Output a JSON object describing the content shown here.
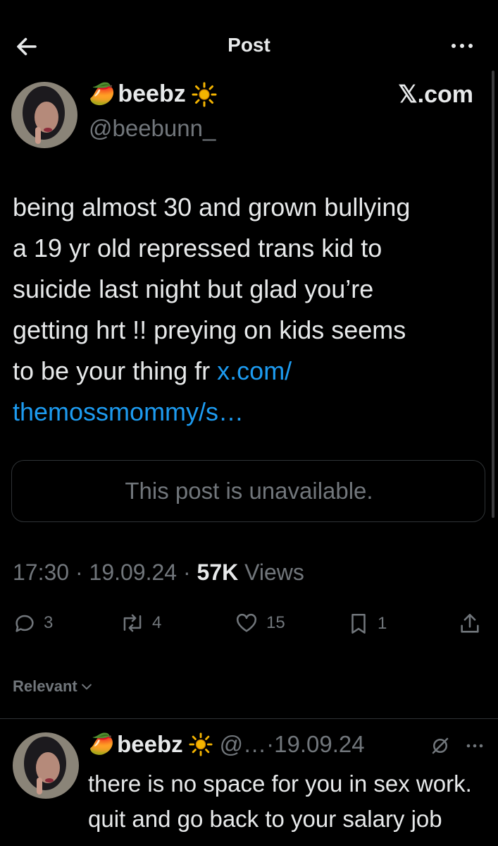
{
  "header": {
    "title": "Post"
  },
  "tweet": {
    "emoji": "🥭",
    "name": "beebz",
    "handle": "@beebunn_",
    "watermark": "𝕏.com",
    "body_lines": [
      "being almost 30 and grown bullying",
      "a 19 yr old repressed trans kid to",
      "suicide last night but glad you’re",
      "getting hrt !! preying on kids seems",
      "to be your thing fr "
    ],
    "link_line1": "x.com/",
    "link_line2": "themossmommy/s…",
    "quote_unavailable": "This post is unavailable.",
    "time": "17:30",
    "date": "19.09.24",
    "views_count": "57K",
    "views_label": "Views",
    "separator": " · ",
    "stats": {
      "replies": "3",
      "reposts": "4",
      "likes": "15",
      "bookmarks": "1"
    }
  },
  "sort": {
    "label": "Relevant"
  },
  "reply": {
    "emoji": "🥭",
    "name": "beebz",
    "handle": "@…",
    "date": "·19.09.24",
    "text": "there is no space for you in sex work. quit and go back to your salary job"
  },
  "colors": {
    "accent": "#1d9bf0",
    "muted": "#71767b",
    "text": "#e7e9ea",
    "border": "#2f3336",
    "background": "#000000"
  },
  "icons": [
    "back-arrow-icon",
    "more-icon",
    "sun-icon",
    "reply-icon",
    "repost-icon",
    "like-icon",
    "bookmark-icon",
    "share-icon",
    "chevron-down-icon",
    "muted-icon"
  ]
}
